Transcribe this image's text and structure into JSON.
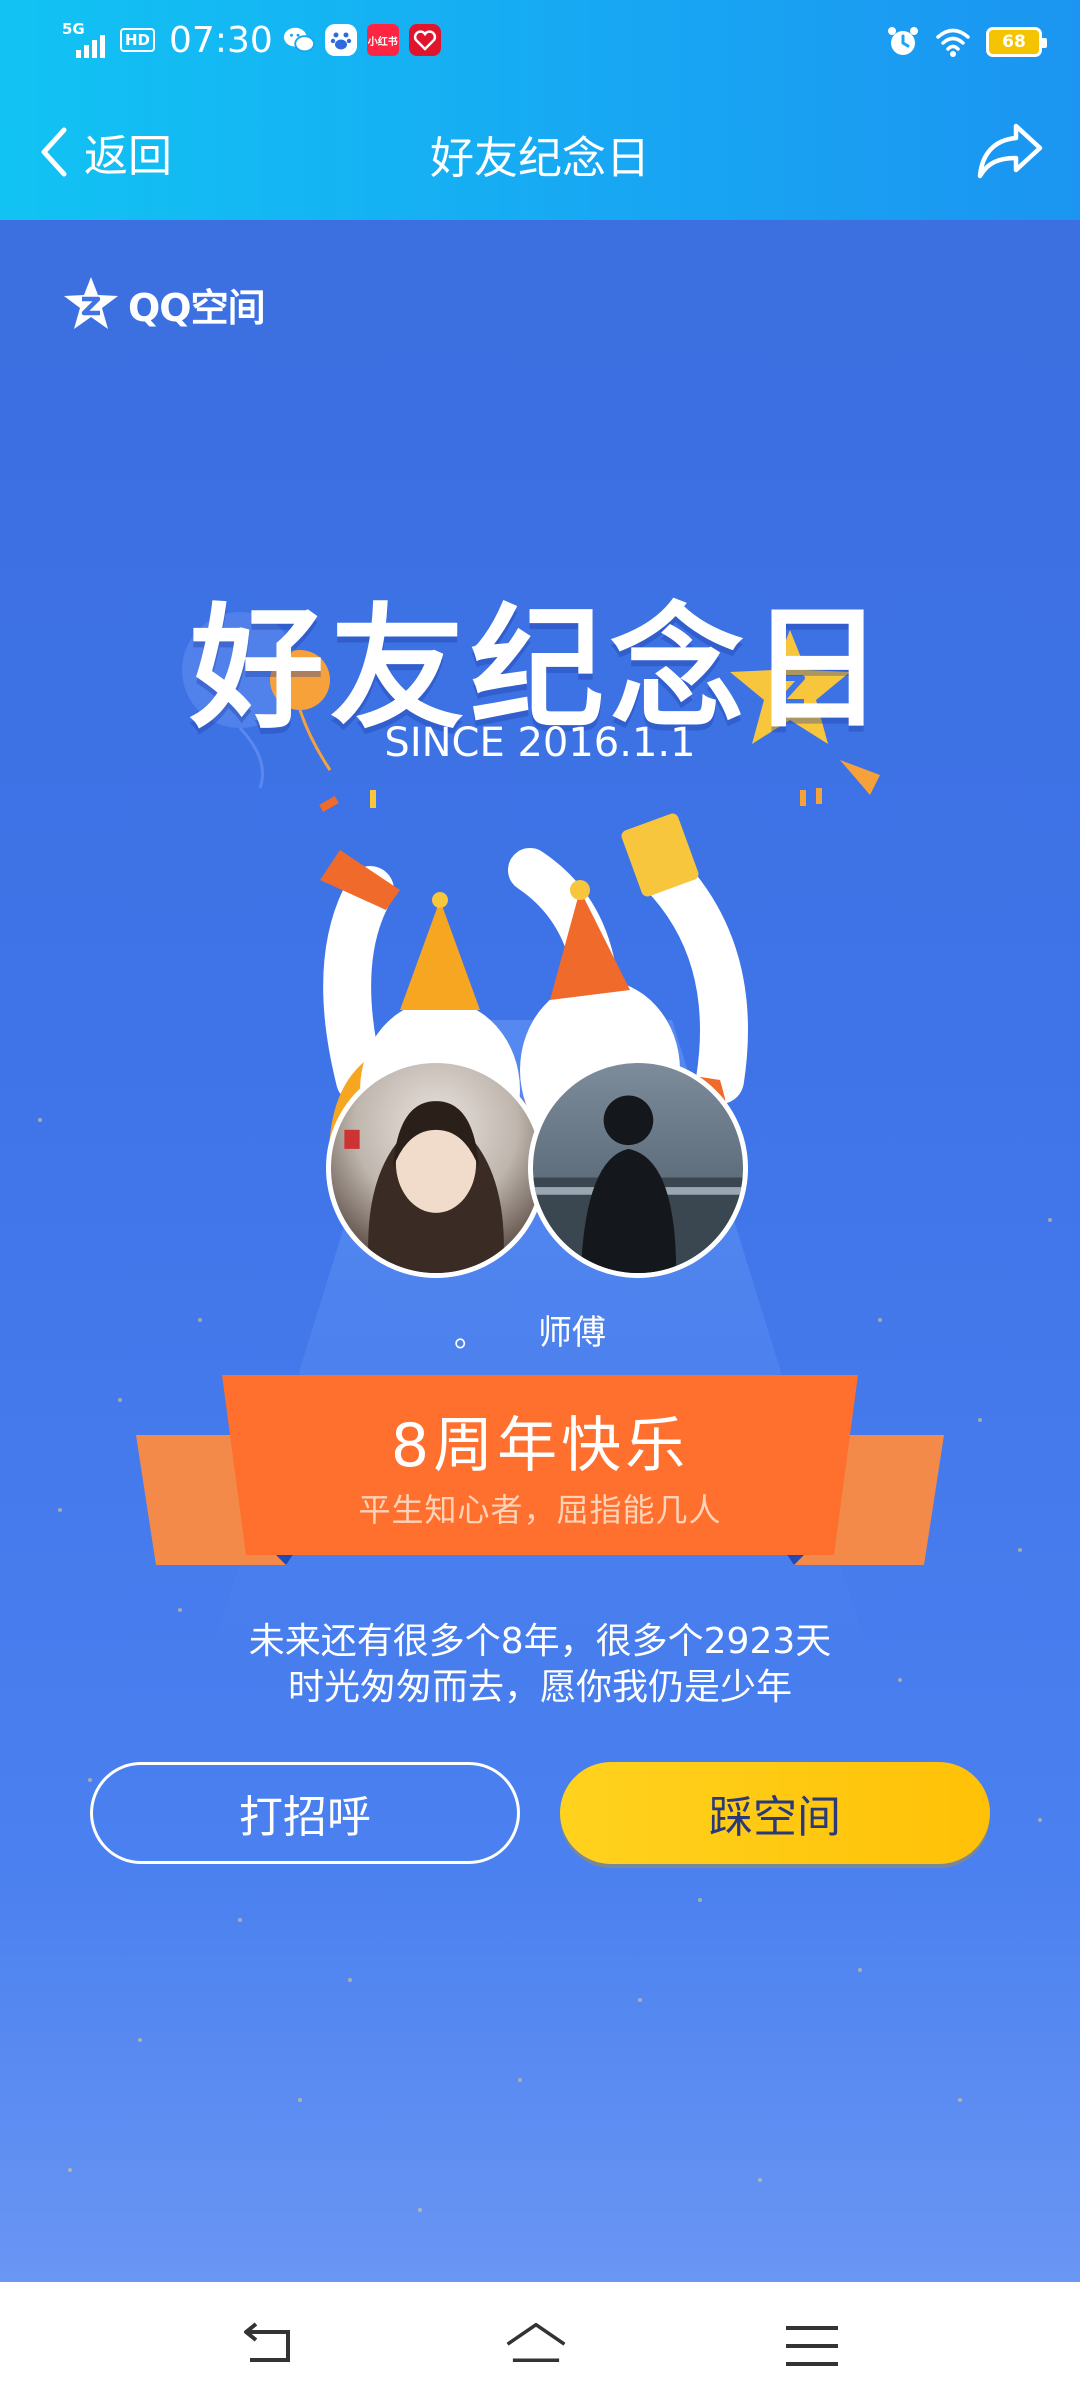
{
  "status_bar": {
    "network": "5G",
    "hd": "HD",
    "time": "07:30",
    "app_icons": [
      "wechat-icon",
      "baidu-icon",
      "xiaohongshu-icon",
      "red-app-icon"
    ],
    "xhs_label": "小红书",
    "battery": "68",
    "battery_color": "#f5c400"
  },
  "header": {
    "back_label": "返回",
    "title": "好友纪念日",
    "share_icon": "share-icon"
  },
  "main": {
    "logo_text": "QQ空间",
    "hero_title": "好友纪念日",
    "since": "SINCE 2016.1.1",
    "friend_left_name": "。",
    "friend_right_name": "师傅",
    "ribbon_title": "8周年快乐",
    "ribbon_subtitle": "平生知心者，屈指能几人",
    "wish_line1": "未来还有很多个8年，很多个2923天",
    "wish_line2": "时光匆匆而去，愿你我仍是少年",
    "greet_button": "打招呼",
    "visit_button": "踩空间"
  },
  "colors": {
    "header_gradient": [
      "#11c3f3",
      "#1b95f1"
    ],
    "background": "#3f73e6",
    "ribbon": "#ff6a2b",
    "visit_button": "#ffc107"
  },
  "system_nav": {
    "icons": [
      "back-nav-icon",
      "home-nav-icon",
      "menu-nav-icon"
    ]
  }
}
